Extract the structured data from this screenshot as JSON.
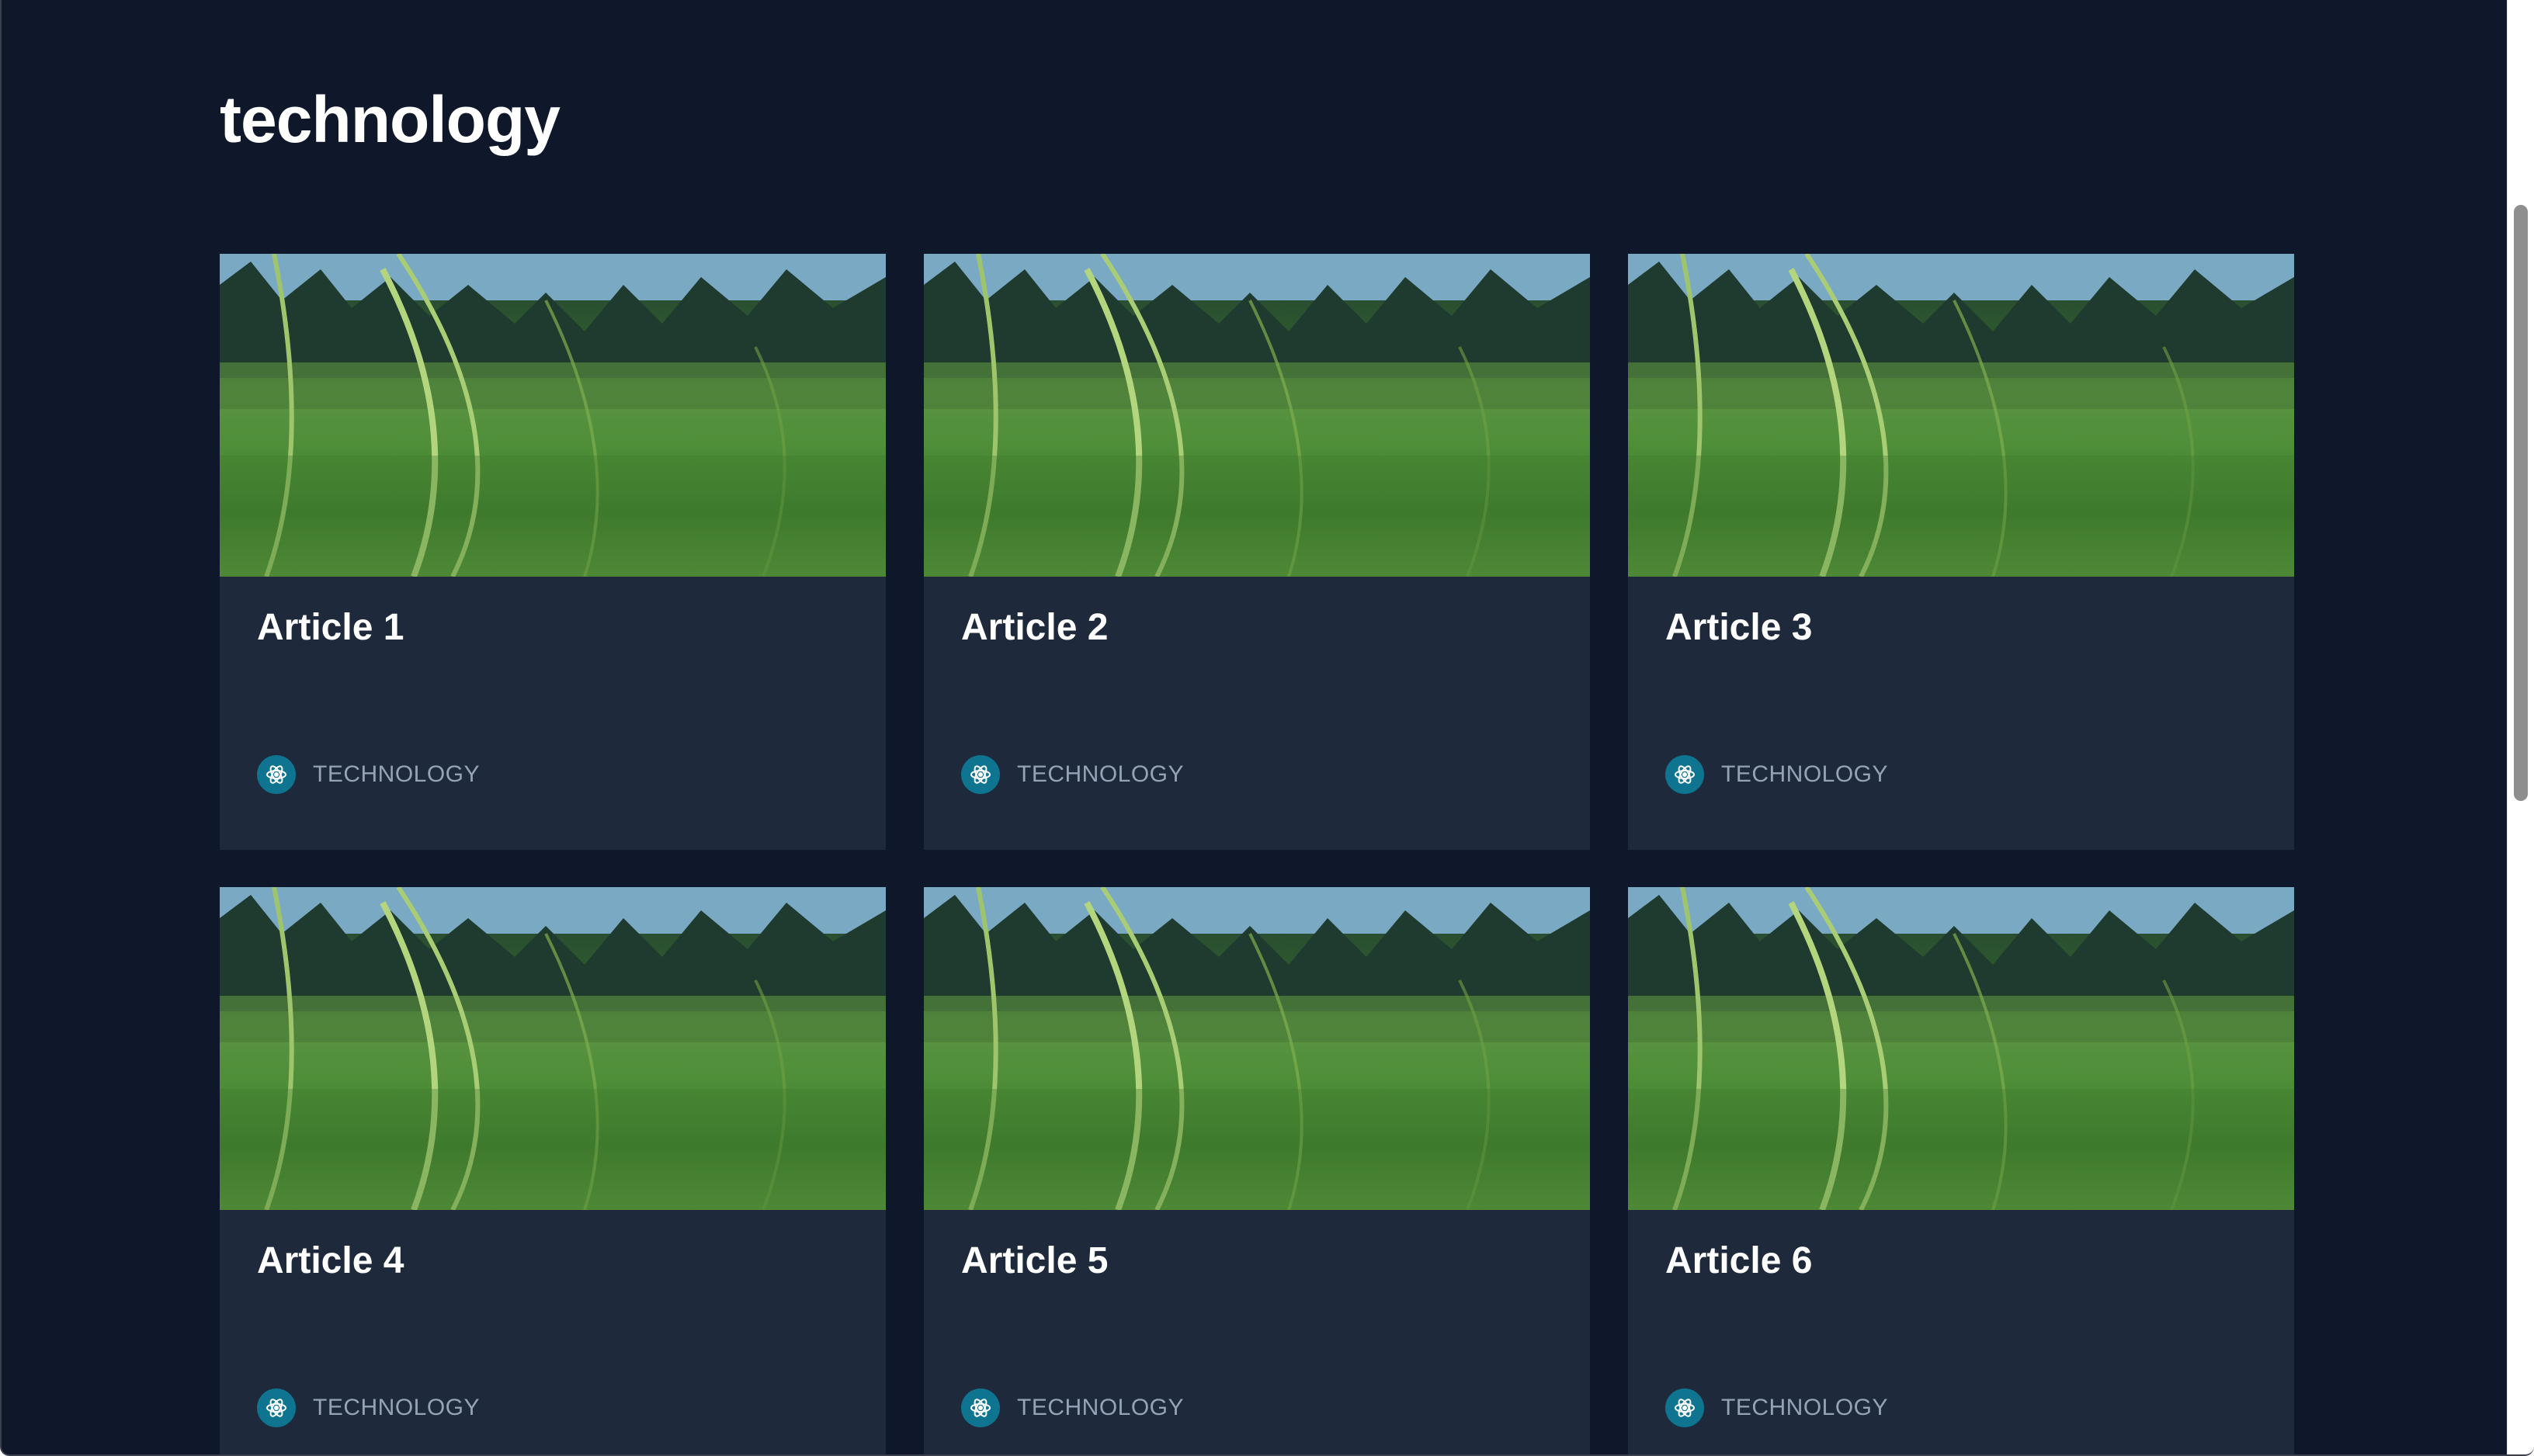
{
  "page": {
    "title": "technology"
  },
  "articles": [
    {
      "title": "Article 1",
      "category": "TECHNOLOGY",
      "category_icon": "atom-icon"
    },
    {
      "title": "Article 2",
      "category": "TECHNOLOGY",
      "category_icon": "atom-icon"
    },
    {
      "title": "Article 3",
      "category": "TECHNOLOGY",
      "category_icon": "atom-icon"
    },
    {
      "title": "Article 4",
      "category": "TECHNOLOGY",
      "category_icon": "atom-icon"
    },
    {
      "title": "Article 5",
      "category": "TECHNOLOGY",
      "category_icon": "atom-icon"
    },
    {
      "title": "Article 6",
      "category": "TECHNOLOGY",
      "category_icon": "atom-icon"
    }
  ],
  "colors": {
    "page_background": "#0f172a",
    "card_background": "#1e293b",
    "title_text": "#ffffff",
    "category_text": "#94a3b8",
    "icon_background": "#0e7490"
  }
}
